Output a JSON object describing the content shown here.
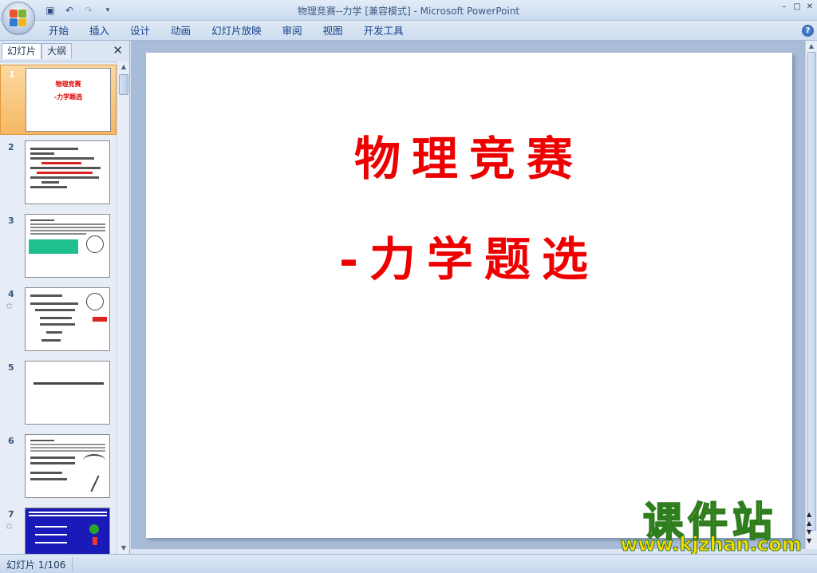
{
  "window": {
    "title": "物理竞赛--力学 [兼容模式] - Microsoft PowerPoint",
    "controls": [
      "–",
      "□",
      "✕"
    ]
  },
  "quick_access": {
    "icons": [
      "save-icon",
      "undo-icon",
      "redo-icon",
      "customize-icon"
    ]
  },
  "ribbon": {
    "tabs": [
      "开始",
      "插入",
      "设计",
      "动画",
      "幻灯片放映",
      "审阅",
      "视图",
      "开发工具"
    ],
    "help": "?"
  },
  "panel": {
    "tab_slides": "幻灯片",
    "tab_outline": "大纲",
    "close": "✕"
  },
  "thumbnails": [
    {
      "num": "1",
      "line1": "物理竞赛",
      "line2": "-力学题选",
      "selected": true
    },
    {
      "num": "2",
      "text": "力学题 运动学 动力学…"
    },
    {
      "num": "3",
      "text": "Hoop on a slope"
    },
    {
      "num": "4",
      "text": "受力分析图"
    },
    {
      "num": "5",
      "text": "弹力在斜面方向（取正方）"
    },
    {
      "num": "6",
      "text": "Defensive Arch"
    },
    {
      "num": "7",
      "text": "blue slide"
    }
  ],
  "slide": {
    "title_line1": "物理竞赛",
    "title_line2": "-力学题选",
    "title_color": "#ee0000"
  },
  "status": {
    "slide_counter": "幻灯片 1/106"
  },
  "watermark": {
    "cn": "课件站",
    "en": "www.kjzhan.com"
  }
}
